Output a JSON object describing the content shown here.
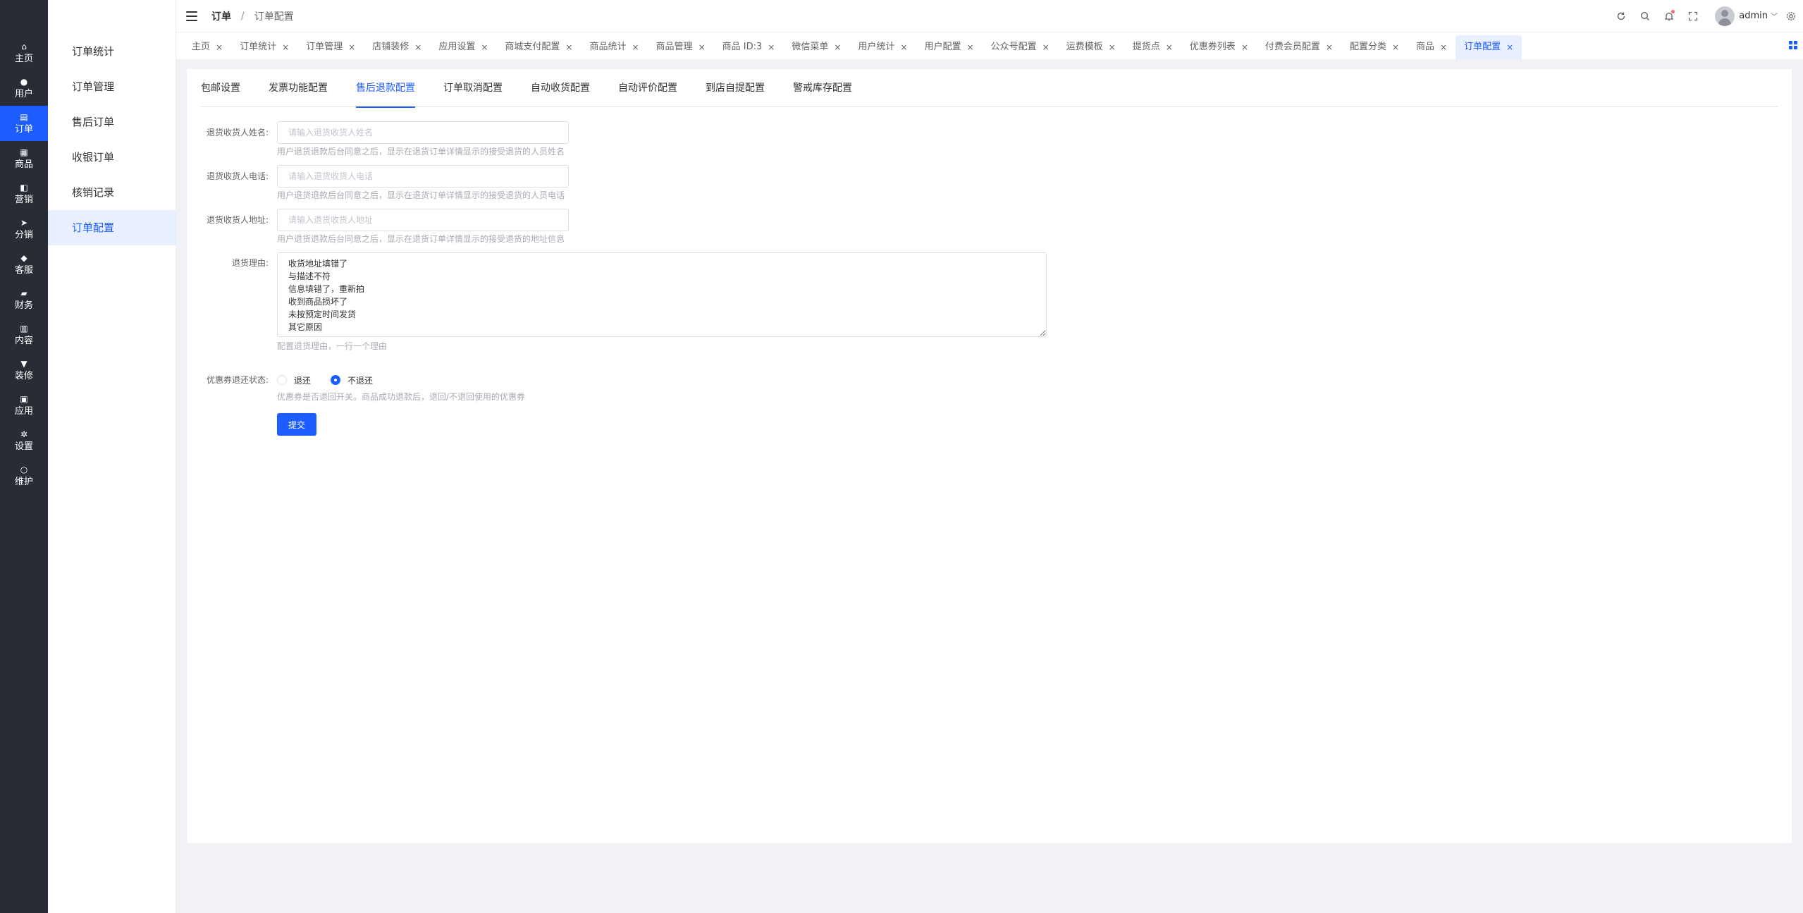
{
  "rail": {
    "items": [
      {
        "label": "主页",
        "icon": "home-icon",
        "glyph": "⌂"
      },
      {
        "label": "用户",
        "icon": "user-icon",
        "glyph": "●"
      },
      {
        "label": "订单",
        "icon": "order-icon",
        "glyph": "▤"
      },
      {
        "label": "商品",
        "icon": "goods-icon",
        "glyph": "▦"
      },
      {
        "label": "营销",
        "icon": "marketing-icon",
        "glyph": "◧"
      },
      {
        "label": "分销",
        "icon": "send-icon",
        "glyph": "➤"
      },
      {
        "label": "客服",
        "icon": "bell-icon",
        "glyph": "◆"
      },
      {
        "label": "财务",
        "icon": "finance-icon",
        "glyph": "▰"
      },
      {
        "label": "内容",
        "icon": "content-icon",
        "glyph": "▥"
      },
      {
        "label": "装修",
        "icon": "brush-icon",
        "glyph": "▼"
      },
      {
        "label": "应用",
        "icon": "apps-icon",
        "glyph": "▣"
      },
      {
        "label": "设置",
        "icon": "gear-icon",
        "glyph": "✲"
      },
      {
        "label": "维护",
        "icon": "maintain-icon",
        "glyph": "○"
      }
    ],
    "active_index": 2
  },
  "submenu": {
    "items": [
      "订单统计",
      "订单管理",
      "售后订单",
      "收银订单",
      "核销记录",
      "订单配置"
    ],
    "active_index": 5
  },
  "header": {
    "breadcrumb_root": "订单",
    "breadcrumb_sep": "/",
    "breadcrumb_current": "订单配置",
    "icons": [
      "refresh-icon",
      "search-icon",
      "bell-icon",
      "fullscreen-icon"
    ],
    "username": "admin"
  },
  "tabs": {
    "items": [
      "主页",
      "订单统计",
      "订单管理",
      "店铺装修",
      "应用设置",
      "商城支付配置",
      "商品统计",
      "商品管理",
      "商品 ID:3",
      "微信菜单",
      "用户统计",
      "用户配置",
      "公众号配置",
      "运费模板",
      "提货点",
      "优惠券列表",
      "付费会员配置",
      "配置分类",
      "商品",
      "订单配置"
    ],
    "close_glyph": "×",
    "active_index": 19
  },
  "subtabs": {
    "items": [
      "包邮设置",
      "发票功能配置",
      "售后退款配置",
      "订单取消配置",
      "自动收货配置",
      "自动评价配置",
      "到店自提配置",
      "警戒库存配置"
    ],
    "active_index": 2
  },
  "form": {
    "name": {
      "label": "退货收货人姓名:",
      "value": "",
      "placeholder": "请输入退货收货人姓名",
      "help": "用户退货退款后台同意之后，显示在退货订单详情显示的接受退货的人员姓名"
    },
    "phone": {
      "label": "退货收货人电话:",
      "value": "",
      "placeholder": "请输入退货收货人电话",
      "help": "用户退货退款后台同意之后，显示在退货订单详情显示的接受退货的人员电话"
    },
    "address": {
      "label": "退货收货人地址:",
      "value": "",
      "placeholder": "请输入退货收货人地址",
      "help": "用户退货退款后台同意之后，显示在退货订单详情显示的接受退货的地址信息"
    },
    "reasons": {
      "label": "退货理由:",
      "value": "收货地址填错了\n与描述不符\n信息填错了，重新拍\n收到商品损坏了\n未按预定时间发货\n其它原因",
      "help": "配置退货理由，一行一个理由"
    },
    "coupon": {
      "label": "优惠券退还状态:",
      "options": [
        "退还",
        "不退还"
      ],
      "selected": "不退还",
      "help": "优惠券是否退回开关。商品成功退款后，退回/不退回使用的优惠券"
    },
    "submit_label": "提交"
  },
  "colors": {
    "accent": "#1d5cff",
    "rail_bg": "#282c34",
    "active_bg": "#e8f0ff"
  }
}
